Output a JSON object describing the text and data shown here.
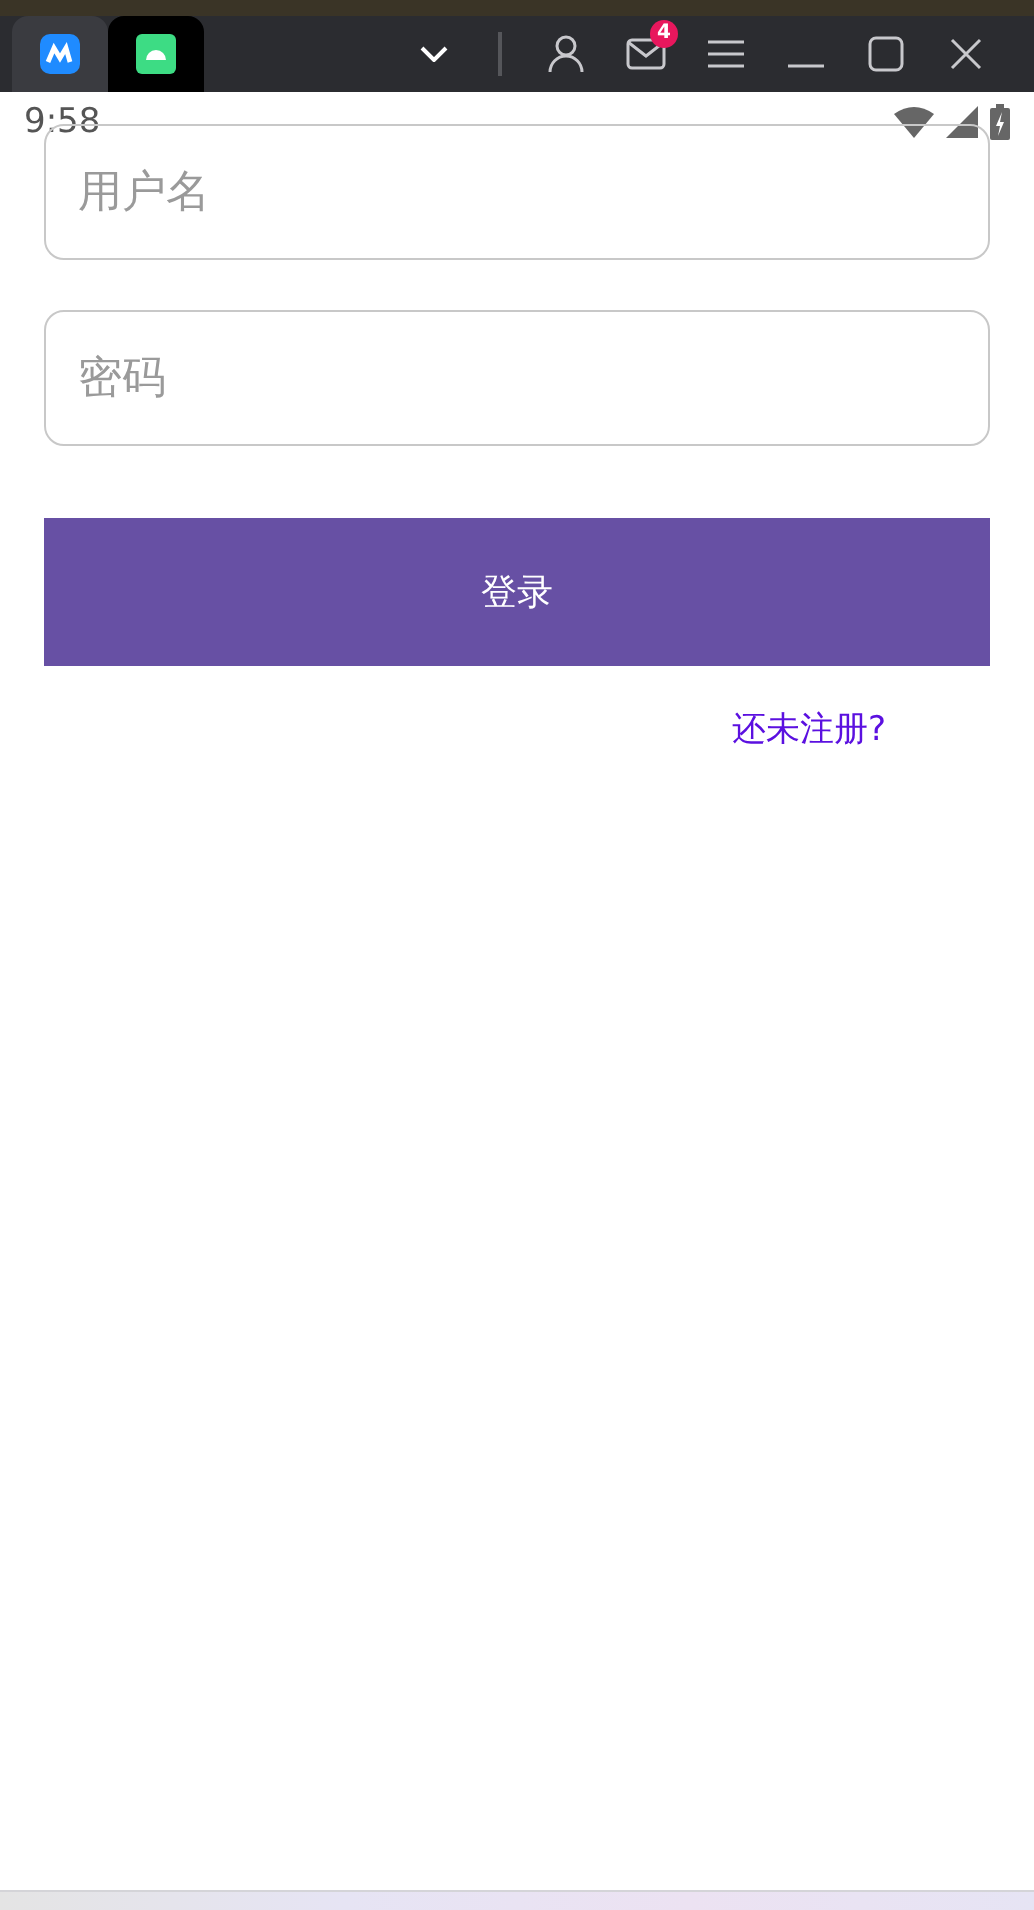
{
  "window": {
    "tabs": [
      {
        "kind": "app",
        "selected": false
      },
      {
        "kind": "android",
        "selected": true
      }
    ],
    "badge": "4"
  },
  "status_bar": {
    "time": "9:58"
  },
  "form": {
    "username": {
      "placeholder": "用户名"
    },
    "password": {
      "placeholder": "密码"
    },
    "login_button": "登录",
    "register_link": "还未注册?"
  }
}
